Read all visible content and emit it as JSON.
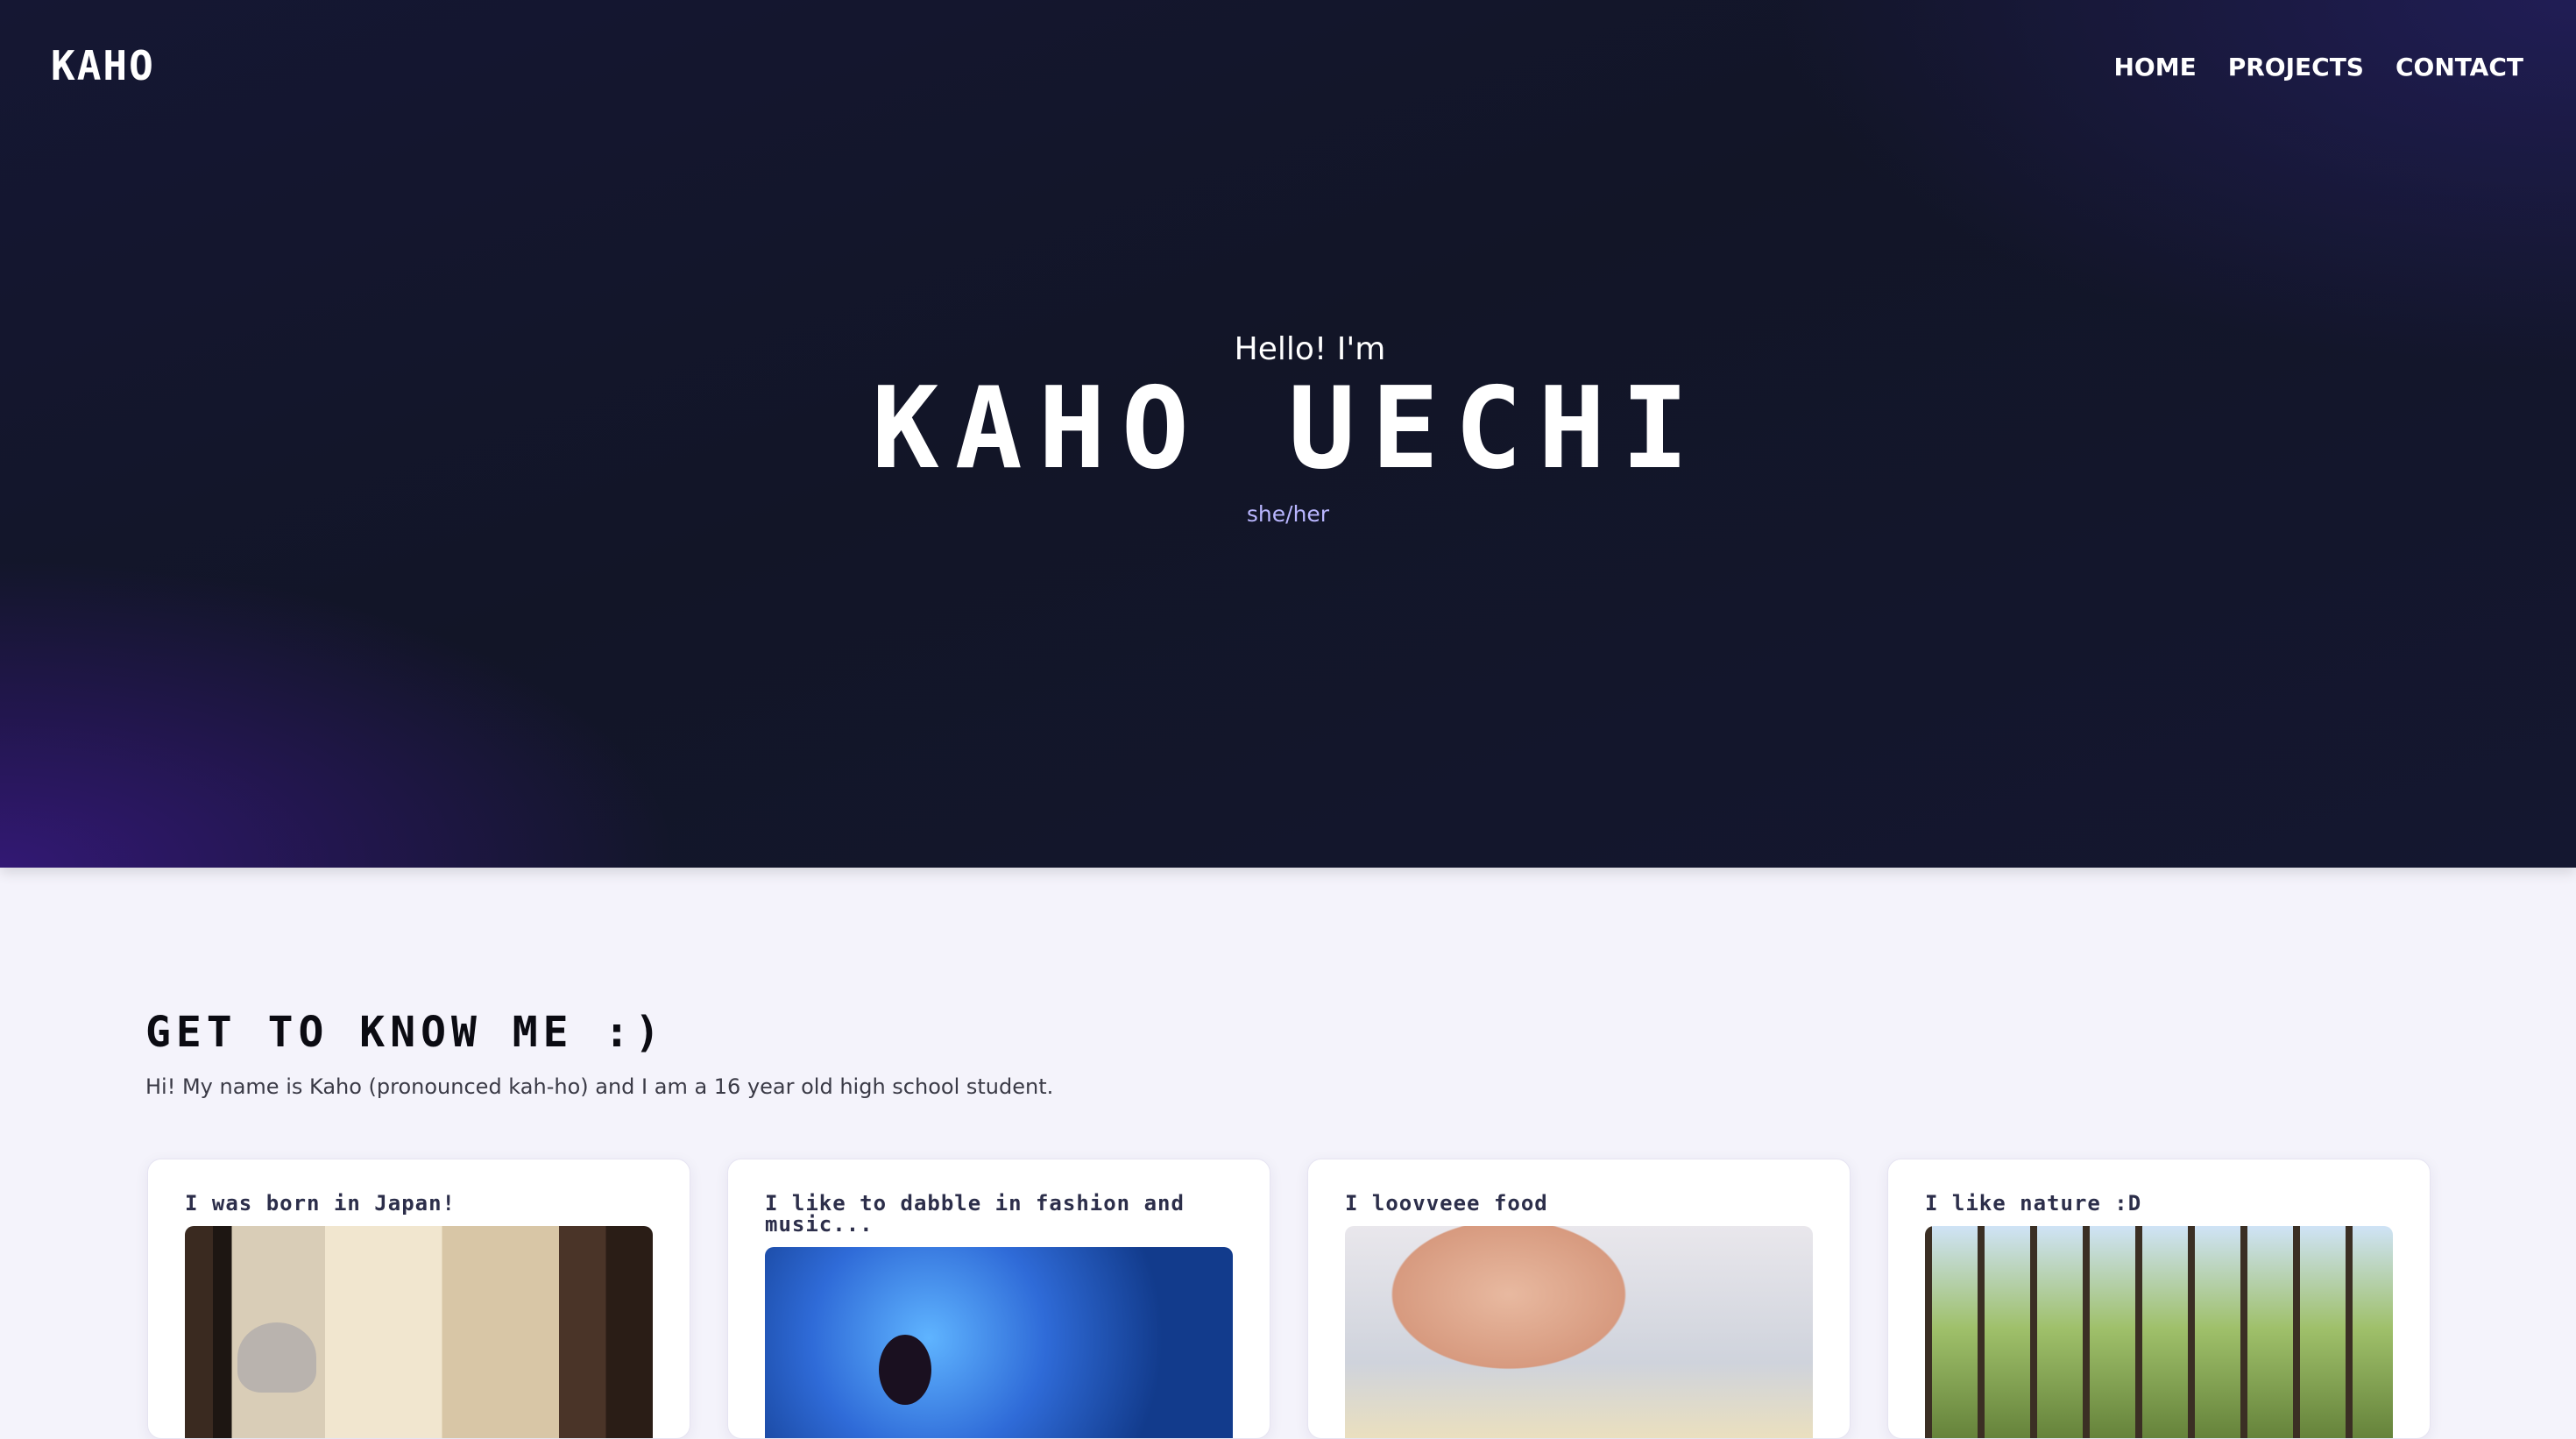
{
  "header": {
    "logo": "KAHO",
    "nav": [
      "HOME",
      "PROJECTS",
      "CONTACT"
    ]
  },
  "hero": {
    "greeting": "Hello! I'm",
    "name": "KAHO UECHI",
    "pronouns": "she/her"
  },
  "about": {
    "title": "GET TO KNOW ME :)",
    "intro": "Hi! My name is Kaho (pronounced kah-ho) and I am a 16 year old high school student.",
    "cards": [
      {
        "title": "I was born in Japan!"
      },
      {
        "title": "I like to dabble in fashion and music..."
      },
      {
        "title": "I loovveee food"
      },
      {
        "title": "I like nature :D"
      }
    ]
  }
}
